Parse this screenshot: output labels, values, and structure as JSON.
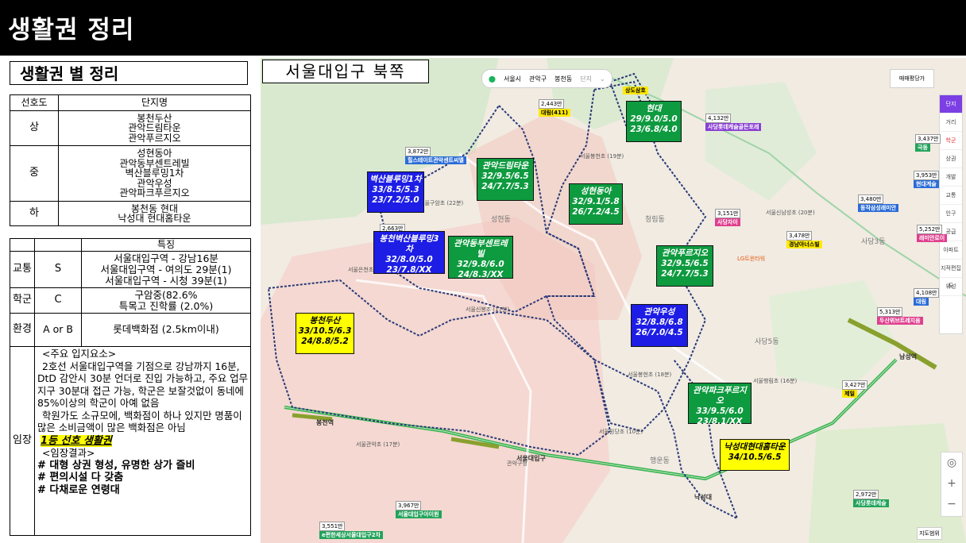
{
  "page": {
    "title": "생활권 정리"
  },
  "left": {
    "subtitle": "생활권 별 정리",
    "pref_table": {
      "headers": [
        "선호도",
        "단지명"
      ],
      "rows": [
        {
          "grade": "상",
          "names": [
            "봉천두산",
            "관악드림타운",
            "관악푸르지오"
          ]
        },
        {
          "grade": "중",
          "names": [
            "성현동아",
            "관악동부센트레빌",
            "벽산블루밍1차",
            "관악우성",
            "관악파크푸르지오"
          ]
        },
        {
          "grade": "하",
          "names": [
            "봉천동 현대",
            "낙성대 현대홈타운"
          ]
        }
      ]
    },
    "feature_table": {
      "header": "특징",
      "transport": {
        "label": "교통",
        "grade": "S",
        "lines": [
          "서울대입구역 - 강남16분",
          "서울대입구역 - 여의도 29분(1)",
          "서울대입구역 - 시청 39분(1)"
        ]
      },
      "school": {
        "label": "학군",
        "grade": "C",
        "lines": [
          "구암중(82.6%",
          "특목고 진학률 (2.0%)"
        ]
      },
      "environment": {
        "label": "환경",
        "grade": "A or B",
        "lines": [
          "롯데백화점 (2.5km이내)"
        ]
      },
      "opinion": {
        "label": "임장",
        "head1": "<주요 입지요소>",
        "p1": "2호선 서울대입구역을 기점으로 강남까지 16분, DtD 감안시 30분 언더로 진입 가능하고, 주요 업무지구 30분대 접근 가능, 학군은 보잘것없이 동네에 85%이상의 학군이 아예 없음",
        "p2": "학원가도 소규모에, 백화점이 하나 있지만 명품이 많은 소비금액이 많은 백화점은 아님",
        "highlight": "1등 선호 생활권",
        "head2": "<임장결과>",
        "results": [
          "# 대형 상권 형성, 유명한 상가 즐비",
          "# 편의시설 다 갖춤",
          "# 다채로운 연령대"
        ]
      }
    }
  },
  "map": {
    "title": "서울대입구 북쪽",
    "nav": {
      "city": "서울시",
      "district": "관악구",
      "dong": "봉천동",
      "filter": "단지"
    },
    "right_filter": "매매평당가",
    "tools": [
      "단지",
      "거리",
      "학군",
      "상권",
      "개발",
      "교통",
      "인구",
      "공급",
      "아파트",
      "지적편집도",
      "위성"
    ],
    "scale": "지도범위",
    "colors": {
      "blue": "#1d1de6",
      "green": "#0e9a3f",
      "yellow": "#ffff00",
      "boundary": "#2b3a78"
    },
    "complexes": [
      {
        "id": "byeoksan",
        "name": "벽산블루밍1차",
        "l1": "33/8.5/5.3",
        "l2": "23/7.2/5.0",
        "color": "blue"
      },
      {
        "id": "dongbu",
        "name": "봉천벽산블루밍3차",
        "l1": "32/8.0/5.0",
        "l2": "23/7.8/XX",
        "color": "blue"
      },
      {
        "id": "dream",
        "name": "관악드림타운",
        "l1": "32/9.5/6.5",
        "l2": "24/7.7/5.3",
        "color": "green"
      },
      {
        "id": "centre",
        "name": "관악동부센트레빌",
        "l1": "32/9.8/6.0",
        "l2": "24/8.3/XX",
        "color": "green"
      },
      {
        "id": "dongah",
        "name": "성현동아",
        "l1": "32/9.1/5.8",
        "l2": "26/7.2/4.5",
        "color": "green"
      },
      {
        "id": "hyundai",
        "name": "현대",
        "l1": "29/9.0/5.0",
        "l2": "23/6.8/4.0",
        "color": "green"
      },
      {
        "id": "prugio",
        "name": "관악푸르지오",
        "l1": "32/9.5/6.5",
        "l2": "24/7.7/5.3",
        "color": "green"
      },
      {
        "id": "woosung",
        "name": "관악우성",
        "l1": "32/8.8/6.8",
        "l2": "26/7.0/4.5",
        "color": "blue"
      },
      {
        "id": "doosan",
        "name": "봉천두산",
        "l1": "33/10.5/6.3",
        "l2": "24/8.8/5.2",
        "color": "yellow"
      },
      {
        "id": "park",
        "name": "관악파크푸르지오",
        "l1": "33/9.5/6.0",
        "l2": "23/8.1/XX",
        "color": "green"
      },
      {
        "id": "nakseong",
        "name": "낙성대현대홈타운",
        "l1": "34/10.5/6.5",
        "l2": "",
        "color": "yellow"
      }
    ],
    "prices": [
      {
        "id": "p1",
        "price": "2,443만",
        "name": "대림(411)"
      },
      {
        "id": "p2",
        "price": "3,872만",
        "name": "힐스테이트관악센트씨엘"
      },
      {
        "id": "p3",
        "price": "4,132만",
        "name": "사당롯데캐슬골든포레"
      },
      {
        "id": "p4",
        "price": "3,437만",
        "name": "극동"
      },
      {
        "id": "p5",
        "price": "3,953만",
        "name": "현대계슬"
      },
      {
        "id": "p6",
        "price": "3,480만",
        "name": "동작삼성래미안"
      },
      {
        "id": "p7",
        "price": "3,151만",
        "name": "사당자이"
      },
      {
        "id": "p8",
        "price": "3,478만",
        "name": "경남아너스빌"
      },
      {
        "id": "p9",
        "price": "5,252만",
        "name": "래미안로이"
      },
      {
        "id": "p10",
        "price": "4,108만",
        "name": "대림"
      },
      {
        "id": "p11",
        "price": "5,313만",
        "name": "두산위브트레지움"
      },
      {
        "id": "p12",
        "price": "3,427만",
        "name": "제일"
      },
      {
        "id": "p13",
        "price": "2,972만",
        "name": "사당롯데캐슬"
      },
      {
        "id": "p14",
        "price": "3,967만",
        "name": "서울대입구아이원"
      },
      {
        "id": "p15",
        "price": "3,551만",
        "name": "e편한세상서울대입구2차"
      }
    ],
    "labels": {
      "l1": "서울봉천초 (19분)",
      "l2": "서울구암초 (22분)",
      "l3": "서울신남성초 (20분)",
      "l4": "서울봉현초 (18분)",
      "l5": "서울신봉초 (17분)",
      "l6": "서울은천초",
      "l7": "서울관악초 (17분)",
      "l8": "서울원당초 (10분)",
      "l9": "서울행림초 (16분)",
      "l10": "성현동",
      "l11": "청림동",
      "l12": "사당3동",
      "l13": "사당5동",
      "l14": "행운동",
      "l15": "서울대입구",
      "l16": "낙성대",
      "l17": "남성역",
      "l18": "봉천역",
      "l19": "상도삼호",
      "l20": "2,663만",
      "l21": "관악구청",
      "l22": "LG트윈타워"
    }
  }
}
